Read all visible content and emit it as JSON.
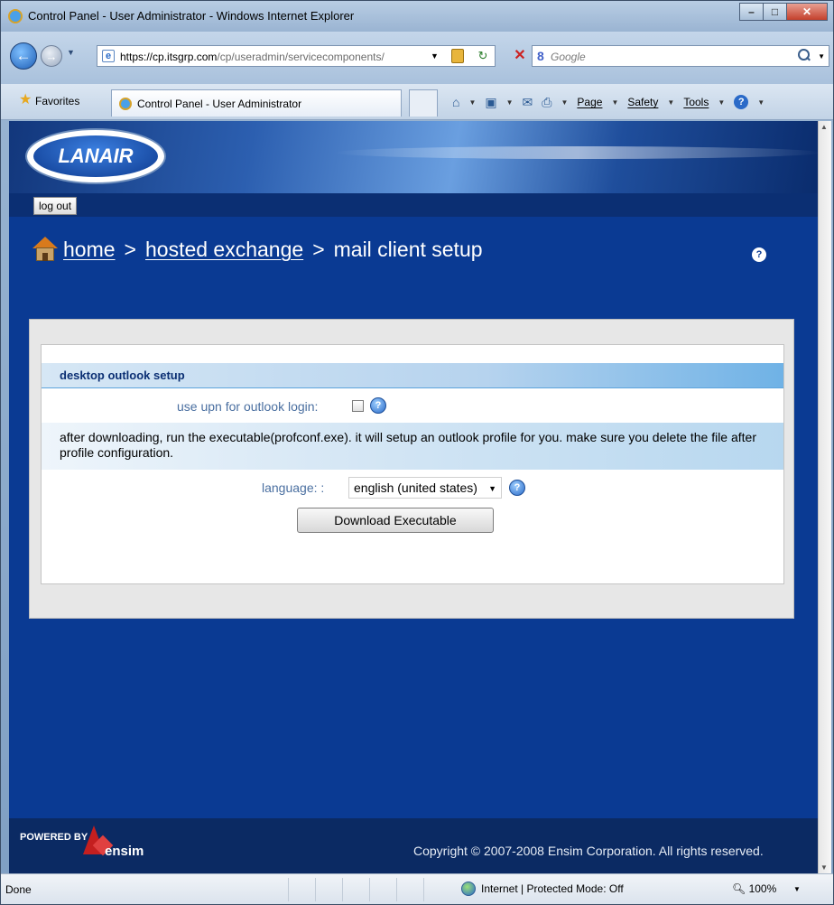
{
  "browser": {
    "window_title": "Control Panel - User Administrator - Windows Internet Explorer",
    "url_host": "https://cp.itsgrp.com",
    "url_path": "/cp/useradmin/servicecomponents/",
    "search_engine_logo": "8",
    "search_placeholder": "Google",
    "favorites_label": "Favorites",
    "tab_label": "Control Panel - User Administrator",
    "menus": {
      "page": "Page",
      "safety": "Safety",
      "tools": "Tools"
    },
    "status": {
      "text": "Done",
      "zone": "Internet | Protected Mode: Off",
      "zoom": "100%"
    }
  },
  "site": {
    "logo_text": "LANAIR",
    "logout_label": "log out",
    "breadcrumb": {
      "home": "home",
      "hosted_exchange": "hosted exchange",
      "current": "mail client setup",
      "separator": ">"
    },
    "help_glyph": "?"
  },
  "outlook_setup": {
    "section_title": "desktop outlook setup",
    "upn_label": "use upn for outlook login:",
    "upn_checked": false,
    "instructions": "after downloading, run the executable(profconf.exe). it will setup an outlook profile for you. make sure you delete the file after profile configuration.",
    "language_label": "language: :",
    "language_selected": "english (united states)",
    "download_button": "Download Executable"
  },
  "footer": {
    "powered_by": "POWERED BY",
    "vendor": "ensim",
    "copyright": "Copyright © 2007-2008 Ensim Corporation. All rights reserved."
  },
  "colors": {
    "page_background": "#0a3a93",
    "panel_background": "#e7e7e7",
    "section_header_accent": "#6fb2e6",
    "footer_background": "#0b2a63"
  }
}
